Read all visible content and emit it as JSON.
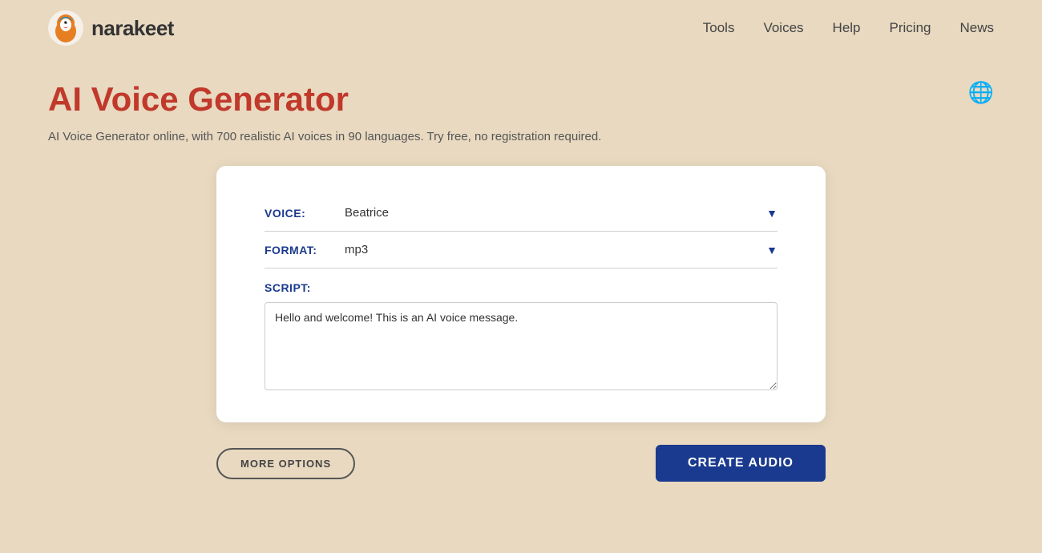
{
  "header": {
    "logo_text": "narakeet",
    "nav": {
      "items": [
        {
          "label": "Tools",
          "name": "tools"
        },
        {
          "label": "Voices",
          "name": "voices"
        },
        {
          "label": "Help",
          "name": "help"
        },
        {
          "label": "Pricing",
          "name": "pricing"
        },
        {
          "label": "News",
          "name": "news"
        }
      ]
    }
  },
  "main": {
    "title": "AI Voice Generator",
    "subtitle": "AI Voice Generator online, with 700 realistic AI voices in 90 languages. Try free, no registration required.",
    "form": {
      "voice_label": "VOICE:",
      "voice_value": "Beatrice",
      "format_label": "FORMAT:",
      "format_value": "mp3",
      "script_label": "SCRIPT:",
      "script_value": "Hello and welcome! This is an AI voice message."
    },
    "buttons": {
      "more_options": "MORE OPTIONS",
      "create_audio": "CREATE AUDIO"
    }
  },
  "icons": {
    "globe": "🌐",
    "dropdown_arrow": "▼"
  }
}
